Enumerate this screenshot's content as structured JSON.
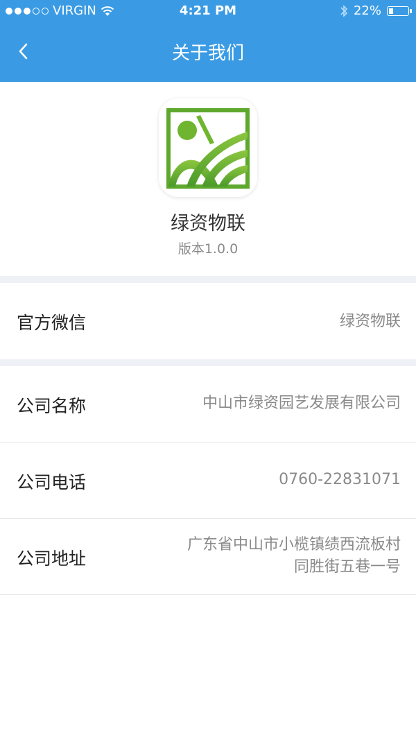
{
  "status_bar": {
    "carrier": "VIRGIN",
    "time": "4:21 PM",
    "battery": "22%",
    "battery_level": 0.22,
    "signal_filled": 3,
    "signal_total": 5
  },
  "nav": {
    "title": "关于我们",
    "back_icon": "chevron-left-icon"
  },
  "app": {
    "name": "绿资物联",
    "version": "版本1.0.0",
    "logo_colors": {
      "green": "#5fa82e",
      "light_green": "#9ccf3f"
    }
  },
  "wechat": {
    "label": "官方微信",
    "value": "绿资物联"
  },
  "company": {
    "name_label": "公司名称",
    "name_value": "中山市绿资园艺发展有限公司",
    "phone_label": "公司电话",
    "phone_value": "0760-22831071",
    "address_label": "公司地址",
    "address_line1": "广东省中山市小榄镇绩西流板村",
    "address_line2": "同胜街五巷一号"
  },
  "colors": {
    "primary": "#3a9be4",
    "separator": "#eef2f6"
  }
}
